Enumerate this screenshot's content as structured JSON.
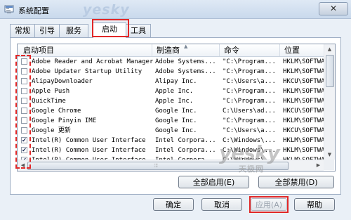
{
  "window": {
    "title": "系统配置",
    "close_symbol": "✕",
    "watermark_top": "yesky"
  },
  "tabs": [
    {
      "label": "常规"
    },
    {
      "label": "引导"
    },
    {
      "label": "服务"
    },
    {
      "label": "启动",
      "active": true
    },
    {
      "label": "工具"
    }
  ],
  "table": {
    "columns": [
      "启动项目",
      "制造商",
      "命令",
      "位置"
    ],
    "sort_arrow": "▲",
    "rows": [
      {
        "checked": false,
        "name": "Adobe Reader and Acrobat Manager",
        "manufacturer": "Adobe Systems...",
        "command": "\"C:\\Program...",
        "location": "HKLM\\SOFTWAR"
      },
      {
        "checked": false,
        "name": "Adobe Updater Startup Utility",
        "manufacturer": "Adobe Systems...",
        "command": "\"C:\\Program...",
        "location": "HKLM\\SOFTWAR"
      },
      {
        "checked": false,
        "name": "AlipayDownloader",
        "manufacturer": "Alipay Inc.",
        "command": "\"C:\\Users\\a...",
        "location": "HKCU\\SOFTWAR"
      },
      {
        "checked": false,
        "name": "Apple Push",
        "manufacturer": "Apple Inc.",
        "command": "\"C:\\Program...",
        "location": "HKLM\\SOFTWAR"
      },
      {
        "checked": false,
        "name": "QuickTime",
        "manufacturer": "Apple Inc.",
        "command": "\"C:\\Program...",
        "location": "HKLM\\SOFTWAR"
      },
      {
        "checked": false,
        "name": "Google Chrome",
        "manufacturer": "Google Inc.",
        "command": "C:\\Users\\ad...",
        "location": "HKCU\\SOFTWAR"
      },
      {
        "checked": false,
        "name": "Google Pinyin IME",
        "manufacturer": "Google Inc.",
        "command": "\"C:\\Program...",
        "location": "HKLM\\SOFTWAR"
      },
      {
        "checked": false,
        "name": "Google 更新",
        "manufacturer": "Google Inc.",
        "command": "\"C:\\Users\\a...",
        "location": "HKCU\\SOFTWAR"
      },
      {
        "checked": true,
        "name": "Intel(R) Common User Interface",
        "manufacturer": "Intel Corpora...",
        "command": "C:\\Windows\\...",
        "location": "HKLM\\SOFTWAR"
      },
      {
        "checked": true,
        "name": "Intel(R) Common User Interface",
        "manufacturer": "Intel Corpora...",
        "command": "C:\\Windows\\...",
        "location": "HKLM\\SOFTWAR"
      },
      {
        "checked": true,
        "name": "Intel(R) Common User Interface",
        "manufacturer": "Intel Corpora...",
        "command": "C:\\Windows\\...",
        "location": "HKLM\\SOFTWAR"
      }
    ]
  },
  "panel_buttons": {
    "enable_all": "全部启用(E)",
    "disable_all": "全部禁用(D)"
  },
  "footer_buttons": {
    "ok": "确定",
    "cancel": "取消",
    "apply": "应用(A)",
    "help": "帮助"
  },
  "watermark": {
    "main": "yesky",
    "sub": "天极网"
  },
  "colors": {
    "highlight_red": "#e12828",
    "window_bg": "#eaf0f7"
  }
}
